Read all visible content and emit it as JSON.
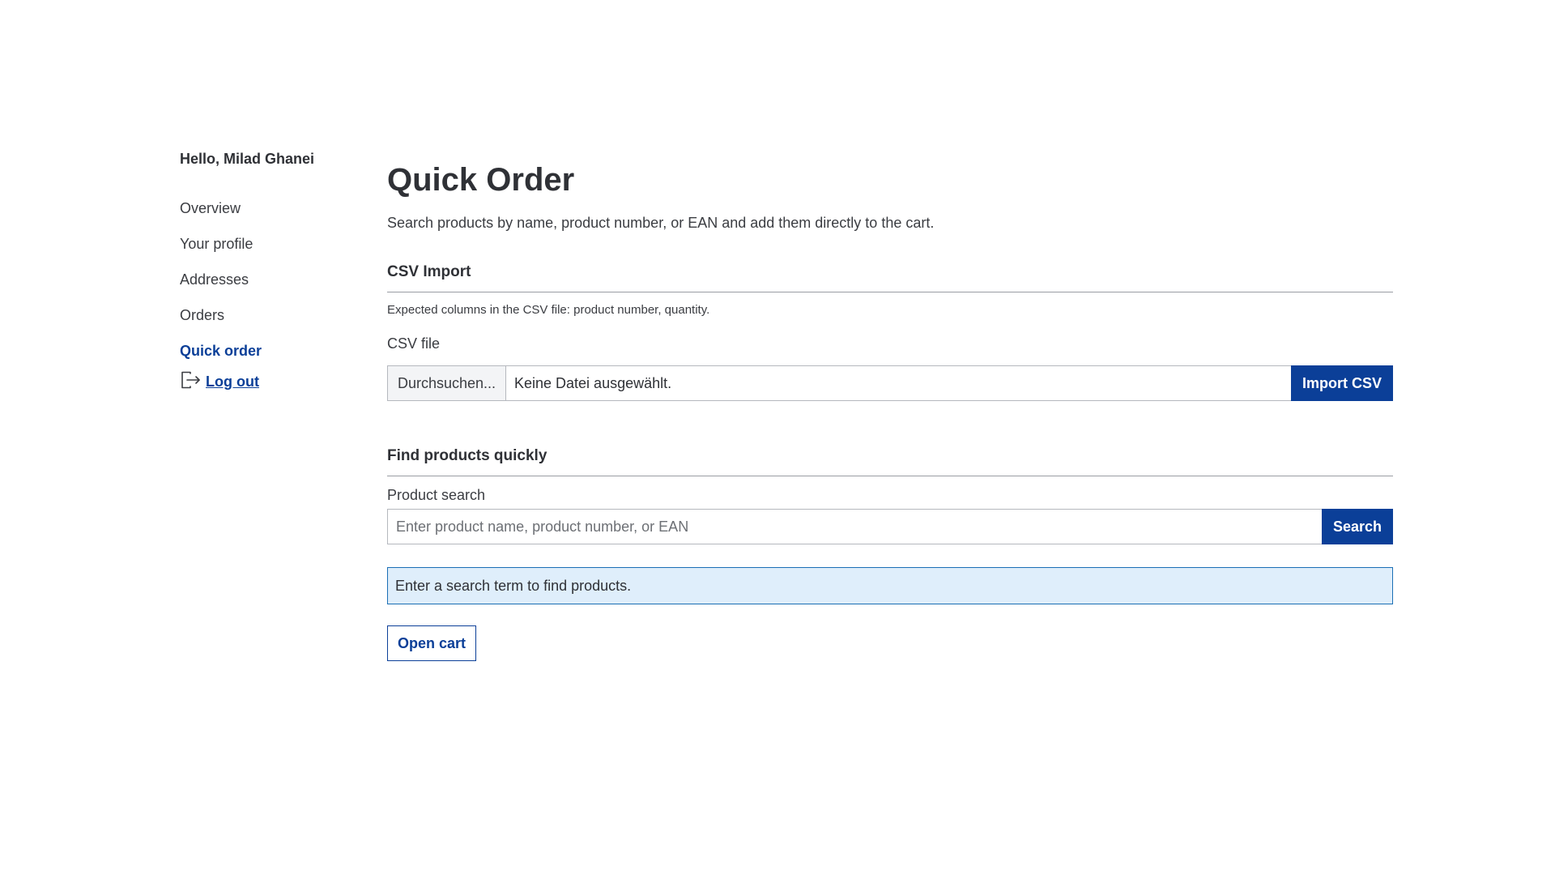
{
  "sidebar": {
    "greeting": "Hello, Milad Ghanei",
    "items": [
      {
        "label": "Overview"
      },
      {
        "label": "Your profile"
      },
      {
        "label": "Addresses"
      },
      {
        "label": "Orders"
      },
      {
        "label": "Quick order",
        "active": true
      }
    ],
    "logout_label": "Log out",
    "logout_icon": "logout-icon"
  },
  "main": {
    "title": "Quick Order",
    "description": "Search products by name, product number, or EAN and add them directly to the cart.",
    "csv_import": {
      "heading": "CSV Import",
      "hint": "Expected columns in the CSV file: product number, quantity.",
      "field_label": "CSV file",
      "browse_label": "Durchsuchen...",
      "file_status": "Keine Datei ausgewählt.",
      "import_button": "Import CSV"
    },
    "find_products": {
      "heading": "Find products quickly",
      "field_label": "Product search",
      "placeholder": "Enter product name, product number, or EAN",
      "value": "",
      "search_button": "Search",
      "info_message": "Enter a search term to find products."
    },
    "open_cart_button": "Open cart"
  },
  "colors": {
    "primary": "#0b3f98",
    "info_background": "#dfeefb",
    "info_border": "#1b6fb5",
    "text": "#2f3136"
  }
}
